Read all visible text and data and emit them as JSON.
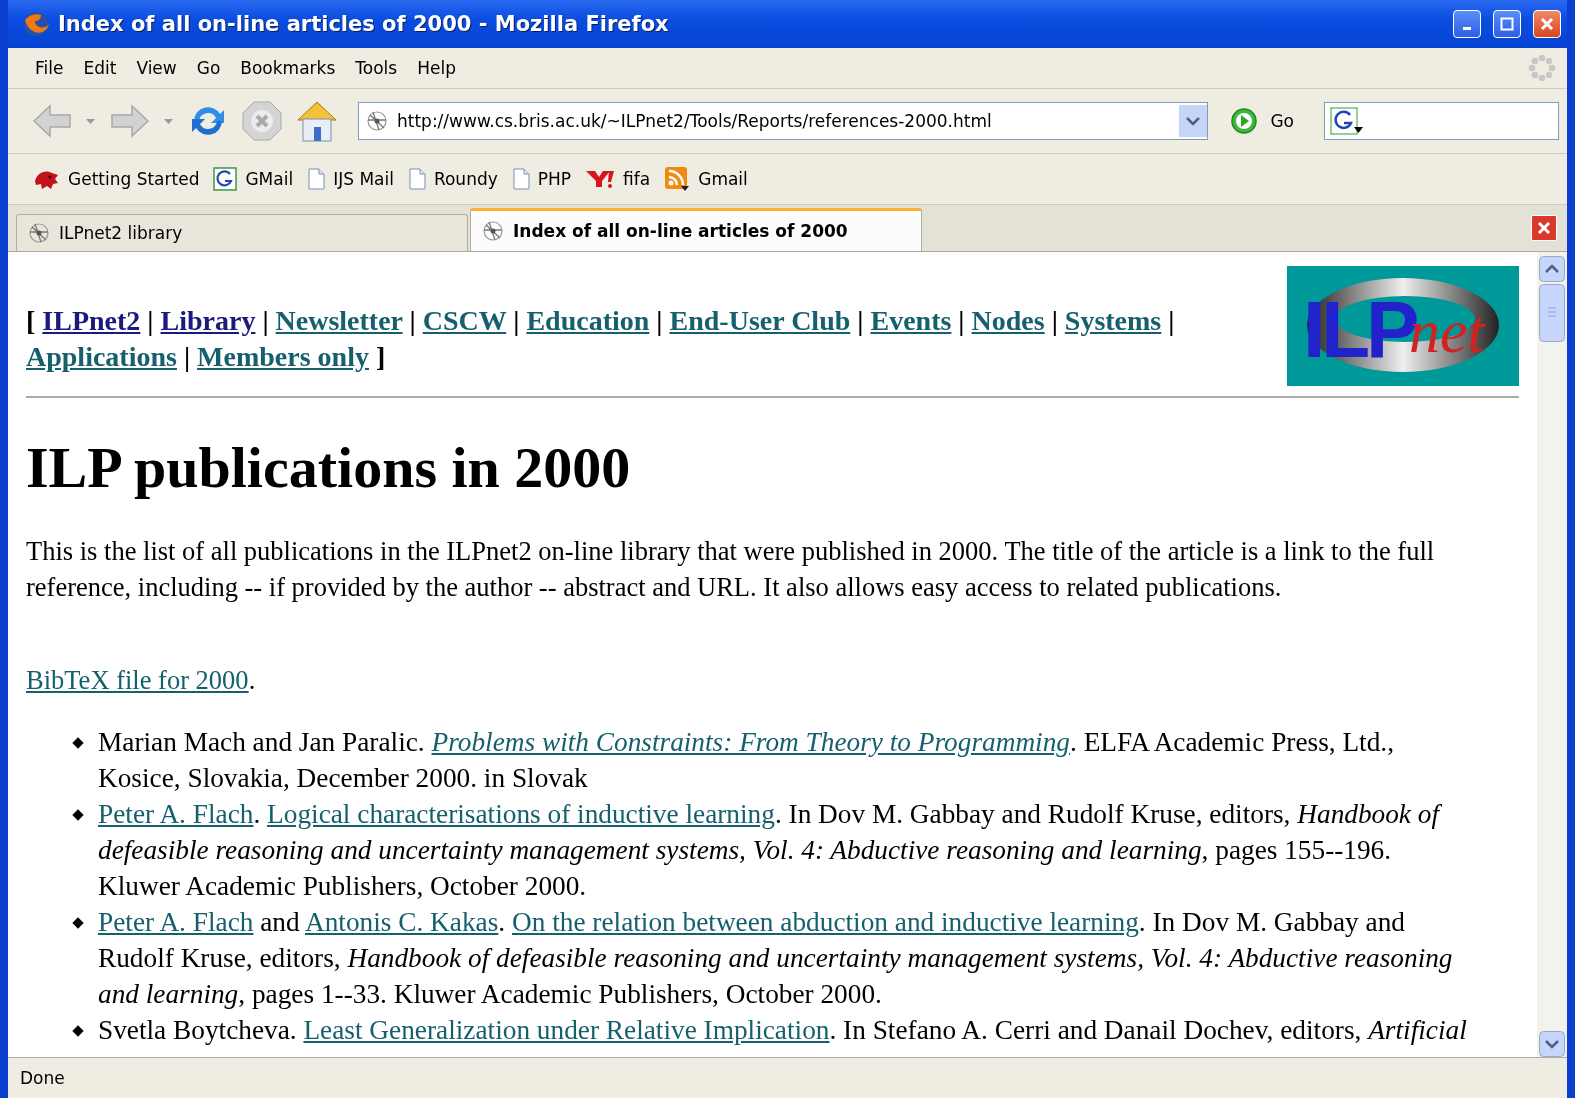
{
  "window": {
    "title": "Index of all on-line articles of 2000 - Mozilla Firefox"
  },
  "menu": [
    "File",
    "Edit",
    "View",
    "Go",
    "Bookmarks",
    "Tools",
    "Help"
  ],
  "address_bar": {
    "url": "http://www.cs.bris.ac.uk/~ILPnet2/Tools/Reports/references-2000.html",
    "go_label": "Go"
  },
  "bookmarks": [
    {
      "label": "Getting Started",
      "kind": "gecko"
    },
    {
      "label": "GMail",
      "kind": "google"
    },
    {
      "label": "IJS Mail",
      "kind": "page"
    },
    {
      "label": "Roundy",
      "kind": "page"
    },
    {
      "label": "PHP",
      "kind": "page"
    },
    {
      "label": "fifa",
      "kind": "yahoo"
    },
    {
      "label": "Gmail",
      "kind": "feed"
    }
  ],
  "tabs": [
    {
      "label": "ILPnet2 library",
      "selected": false
    },
    {
      "label": "Index of all on-line articles of 2000",
      "selected": true
    }
  ],
  "page": {
    "nav": [
      {
        "kind": "punct",
        "text": "["
      },
      {
        "kind": "link",
        "text": "ILPnet2",
        "visited": false
      },
      {
        "kind": "punct",
        "text": "|"
      },
      {
        "kind": "link",
        "text": "Library",
        "visited": false
      },
      {
        "kind": "punct",
        "text": "|"
      },
      {
        "kind": "link",
        "text": "Newsletter",
        "visited": true
      },
      {
        "kind": "punct",
        "text": "|"
      },
      {
        "kind": "link",
        "text": "CSCW",
        "visited": true
      },
      {
        "kind": "punct",
        "text": "|"
      },
      {
        "kind": "link",
        "text": "Education",
        "visited": true
      },
      {
        "kind": "punct",
        "text": "|"
      },
      {
        "kind": "link",
        "text": "End-User Club",
        "visited": true
      },
      {
        "kind": "punct",
        "text": "|"
      },
      {
        "kind": "link",
        "text": "Events",
        "visited": true
      },
      {
        "kind": "punct",
        "text": "|"
      },
      {
        "kind": "link",
        "text": "Nodes",
        "visited": true
      },
      {
        "kind": "punct",
        "text": "|"
      },
      {
        "kind": "link",
        "text": "Systems",
        "visited": true
      },
      {
        "kind": "punct",
        "text": "|"
      },
      {
        "kind": "link",
        "text": "Applications",
        "visited": true
      },
      {
        "kind": "punct",
        "text": "|"
      },
      {
        "kind": "link",
        "text": "Members only",
        "visited": true
      },
      {
        "kind": "punct",
        "text": "]"
      }
    ],
    "logo": {
      "main": "ILP",
      "script": "net"
    },
    "heading": "ILP publications in 2000",
    "intro": "This is the list of all publications in the ILPnet2 on-line library that were published in 2000. The title of the article is a link to the full reference, including -- if provided by the author -- abstract and URL. It also allows easy access to related publications.",
    "bibtex": {
      "link": "BibTeX file for 2000",
      "after": "."
    },
    "references": [
      {
        "segments": [
          {
            "kind": "text",
            "text": "Marian Mach and Jan Paralic. "
          },
          {
            "kind": "italic-link",
            "text": "Problems with Constraints: From Theory to Programming"
          },
          {
            "kind": "text",
            "text": ". ELFA Academic Press, Ltd., Kosice, Slovakia, December 2000. in Slovak"
          }
        ]
      },
      {
        "segments": [
          {
            "kind": "link",
            "text": "Peter A. Flach"
          },
          {
            "kind": "text",
            "text": ". "
          },
          {
            "kind": "link",
            "text": "Logical characterisations of inductive learning"
          },
          {
            "kind": "text",
            "text": ". In Dov M. Gabbay and Rudolf Kruse, editors, "
          },
          {
            "kind": "italic",
            "text": "Handbook of defeasible reasoning and uncertainty management systems, Vol. 4: Abductive reasoning and learning"
          },
          {
            "kind": "text",
            "text": ", pages 155--196. Kluwer Academic Publishers, October 2000."
          }
        ]
      },
      {
        "segments": [
          {
            "kind": "link",
            "text": "Peter A. Flach"
          },
          {
            "kind": "text",
            "text": " and "
          },
          {
            "kind": "link",
            "text": "Antonis C. Kakas"
          },
          {
            "kind": "text",
            "text": ". "
          },
          {
            "kind": "link",
            "text": "On the relation between abduction and inductive learning"
          },
          {
            "kind": "text",
            "text": ". In Dov M. Gabbay and Rudolf Kruse, editors, "
          },
          {
            "kind": "italic",
            "text": "Handbook of defeasible reasoning and uncertainty management systems, Vol. 4: Abductive reasoning and learning"
          },
          {
            "kind": "text",
            "text": ", pages 1--33. Kluwer Academic Publishers, October 2000."
          }
        ]
      },
      {
        "segments": [
          {
            "kind": "text",
            "text": "Svetla Boytcheva. "
          },
          {
            "kind": "link",
            "text": "Least Generalization under Relative Implication"
          },
          {
            "kind": "text",
            "text": ". In Stefano A. Cerri and Danail Dochev, editors, "
          },
          {
            "kind": "italic",
            "text": "Artificial"
          }
        ]
      }
    ]
  },
  "status_bar": {
    "text": "Done"
  }
}
